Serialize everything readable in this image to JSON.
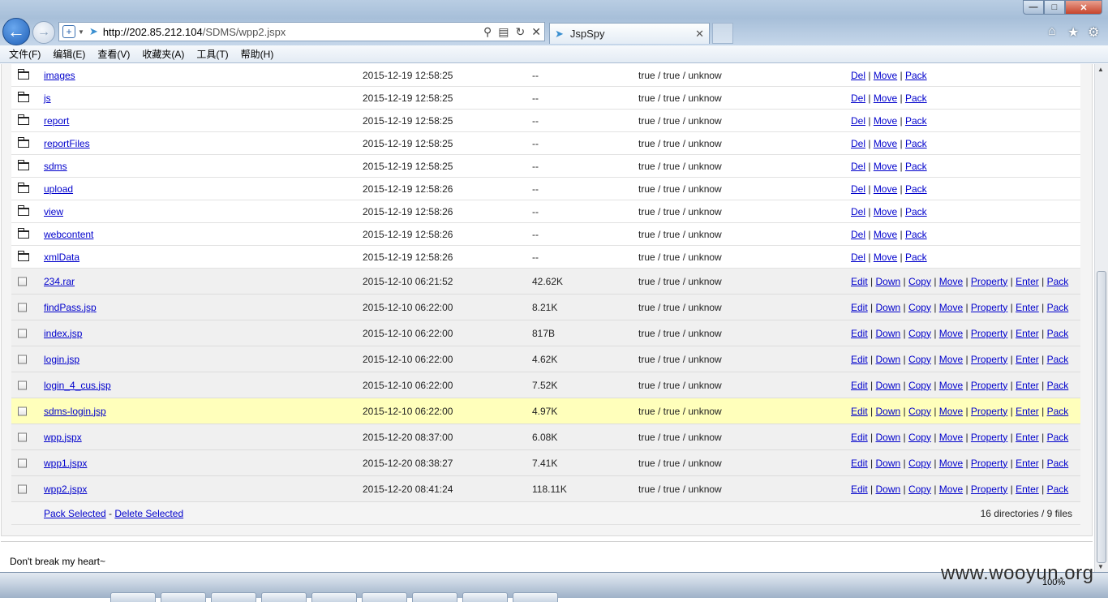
{
  "browser": {
    "url_host": "http://202.85.212.104",
    "url_path": "/SDMS/wpp2.jspx",
    "tab_title": "JspSpy",
    "menu": [
      "文件(F)",
      "编辑(E)",
      "查看(V)",
      "收藏夹(A)",
      "工具(T)",
      "帮助(H)"
    ],
    "zoom": "100%"
  },
  "directories": [
    {
      "name": "images",
      "date": "2015-12-19 12:58:25",
      "size": "--",
      "perm": "true / true / unknow"
    },
    {
      "name": "js",
      "date": "2015-12-19 12:58:25",
      "size": "--",
      "perm": "true / true / unknow"
    },
    {
      "name": "report",
      "date": "2015-12-19 12:58:25",
      "size": "--",
      "perm": "true / true / unknow"
    },
    {
      "name": "reportFiles",
      "date": "2015-12-19 12:58:25",
      "size": "--",
      "perm": "true / true / unknow"
    },
    {
      "name": "sdms",
      "date": "2015-12-19 12:58:25",
      "size": "--",
      "perm": "true / true / unknow"
    },
    {
      "name": "upload",
      "date": "2015-12-19 12:58:26",
      "size": "--",
      "perm": "true / true / unknow"
    },
    {
      "name": "view",
      "date": "2015-12-19 12:58:26",
      "size": "--",
      "perm": "true / true / unknow"
    },
    {
      "name": "webcontent",
      "date": "2015-12-19 12:58:26",
      "size": "--",
      "perm": "true / true / unknow"
    },
    {
      "name": "xmlData",
      "date": "2015-12-19 12:58:26",
      "size": "--",
      "perm": "true / true / unknow"
    }
  ],
  "dir_actions": [
    "Del",
    "Move",
    "Pack"
  ],
  "files": [
    {
      "name": "234.rar",
      "date": "2015-12-10 06:21:52",
      "size": "42.62K",
      "perm": "true / true / unknow",
      "highlight": false
    },
    {
      "name": "findPass.jsp",
      "date": "2015-12-10 06:22:00",
      "size": "8.21K",
      "perm": "true / true / unknow",
      "highlight": false
    },
    {
      "name": "index.jsp",
      "date": "2015-12-10 06:22:00",
      "size": "817B",
      "perm": "true / true / unknow",
      "highlight": false
    },
    {
      "name": "login.jsp",
      "date": "2015-12-10 06:22:00",
      "size": "4.62K",
      "perm": "true / true / unknow",
      "highlight": false
    },
    {
      "name": "login_4_cus.jsp",
      "date": "2015-12-10 06:22:00",
      "size": "7.52K",
      "perm": "true / true / unknow",
      "highlight": false
    },
    {
      "name": "sdms-login.jsp",
      "date": "2015-12-10 06:22:00",
      "size": "4.97K",
      "perm": "true / true / unknow",
      "highlight": true
    },
    {
      "name": "wpp.jspx",
      "date": "2015-12-20 08:37:00",
      "size": "6.08K",
      "perm": "true / true / unknow",
      "highlight": false
    },
    {
      "name": "wpp1.jspx",
      "date": "2015-12-20 08:38:27",
      "size": "7.41K",
      "perm": "true / true / unknow",
      "highlight": false
    },
    {
      "name": "wpp2.jspx",
      "date": "2015-12-20 08:41:24",
      "size": "118.11K",
      "perm": "true / true / unknow",
      "highlight": false
    }
  ],
  "file_actions": [
    "Edit",
    "Down",
    "Copy",
    "Move",
    "Property",
    "Enter",
    "Pack"
  ],
  "footer": {
    "pack_selected": "Pack Selected",
    "separator": " - ",
    "delete_selected": "Delete Selected",
    "summary": "16 directories / 9 files"
  },
  "signature": "Don't break my heart~",
  "watermark": "www.wooyun.org"
}
